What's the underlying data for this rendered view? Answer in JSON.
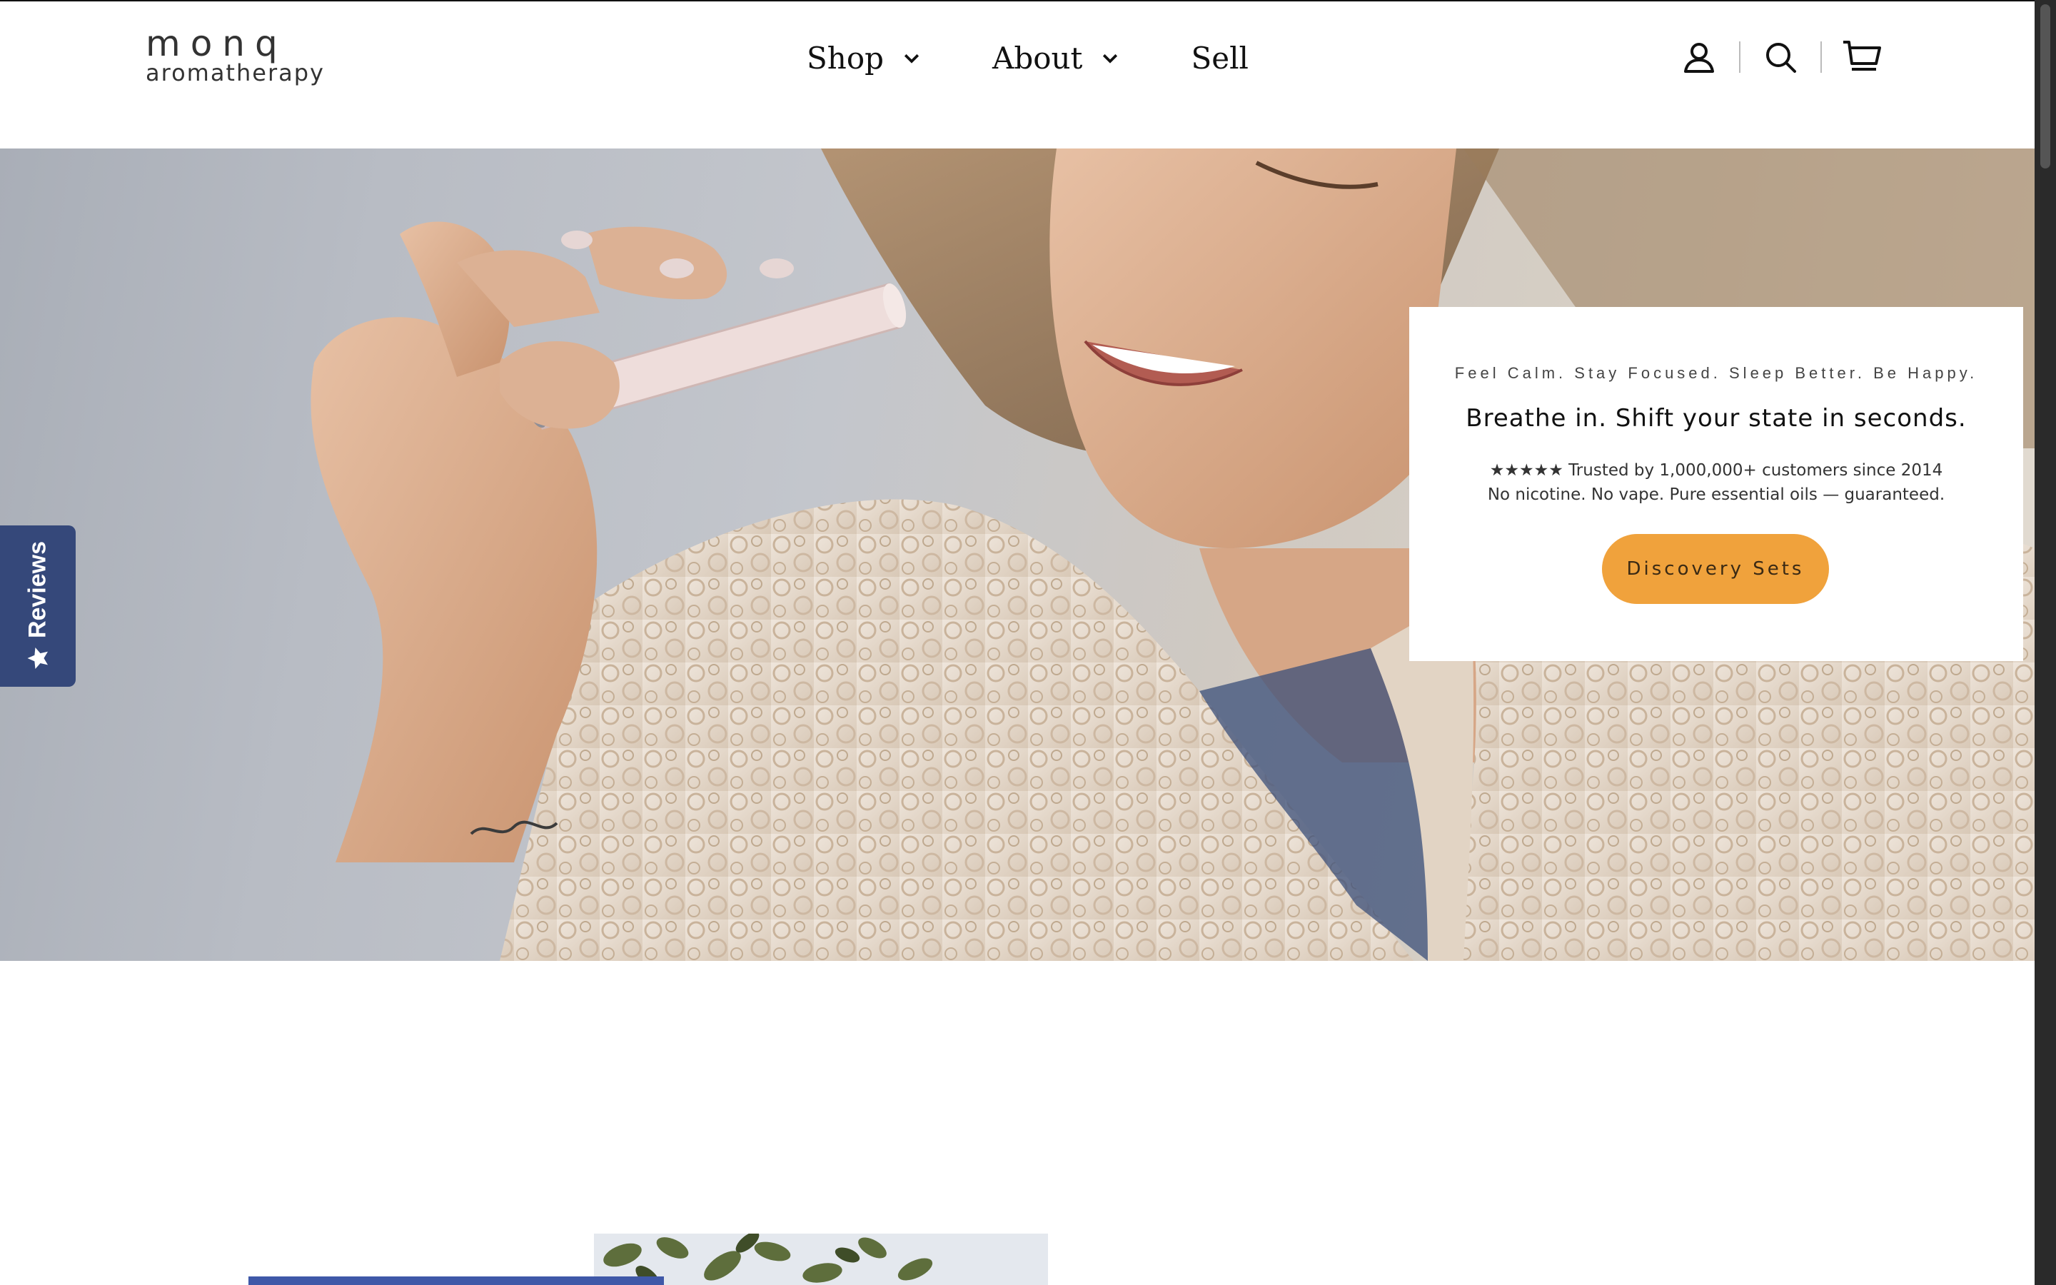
{
  "brand": {
    "logo_mark": "monq",
    "logo_sub": "aromatherapy"
  },
  "nav": {
    "items": [
      {
        "label": "Shop",
        "has_dropdown": true
      },
      {
        "label": "About",
        "has_dropdown": true
      },
      {
        "label": "Sell",
        "has_dropdown": false
      }
    ]
  },
  "header_icons": [
    "account-icon",
    "search-icon",
    "cart-icon"
  ],
  "hero": {
    "tagline": "Feel Calm. Stay Focused. Sleep Better. Be Happy.",
    "title": "Breathe in. Shift your state in seconds.",
    "trust_line": "★★★★★ Trusted by 1,000,000+ customers since 2014",
    "guarantee_line": "No nicotine. No vape. Pure essential oils — guaranteed.",
    "cta_label": "Discovery Sets"
  },
  "reviews_tab": {
    "label": "Reviews",
    "icon": "star-icon"
  },
  "colors": {
    "cta": "#f0a23c",
    "reviews_tab": "#35487a",
    "text": "#111111"
  }
}
